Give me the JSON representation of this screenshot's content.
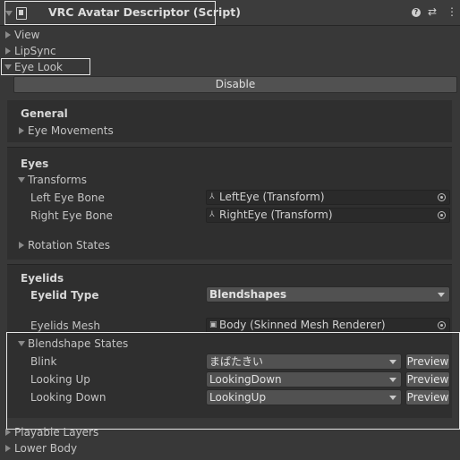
{
  "header": {
    "title": "VRC Avatar Descriptor (Script)"
  },
  "sections": {
    "view": "View",
    "lipsync": "LipSync",
    "eye_look": "Eye Look",
    "playable_layers": "Playable Layers",
    "lower_body": "Lower Body"
  },
  "disable_button": "Disable",
  "general": {
    "title": "General",
    "eye_movements": "Eye Movements"
  },
  "eyes": {
    "title": "Eyes",
    "transforms": "Transforms",
    "left_eye_label": "Left Eye Bone",
    "left_eye_value": "LeftEye (Transform)",
    "right_eye_label": "Right Eye Bone",
    "right_eye_value": "RightEye (Transform)",
    "rotation_states": "Rotation States"
  },
  "eyelids": {
    "title": "Eyelids",
    "type_label": "Eyelid Type",
    "type_value": "Blendshapes",
    "mesh_label": "Eyelids Mesh",
    "mesh_value": "Body (Skinned Mesh Renderer)",
    "blendshape_states": "Blendshape States",
    "rows": [
      {
        "label": "Blink",
        "value": "まばたきい",
        "button": "Preview"
      },
      {
        "label": "Looking Up",
        "value": "LookingDown",
        "button": "Preview"
      },
      {
        "label": "Looking Down",
        "value": "LookingUp",
        "button": "Preview"
      }
    ]
  },
  "colors": {
    "background": "#383838",
    "panel": "#2f2f2f",
    "highlight": "#e6e6e6"
  }
}
